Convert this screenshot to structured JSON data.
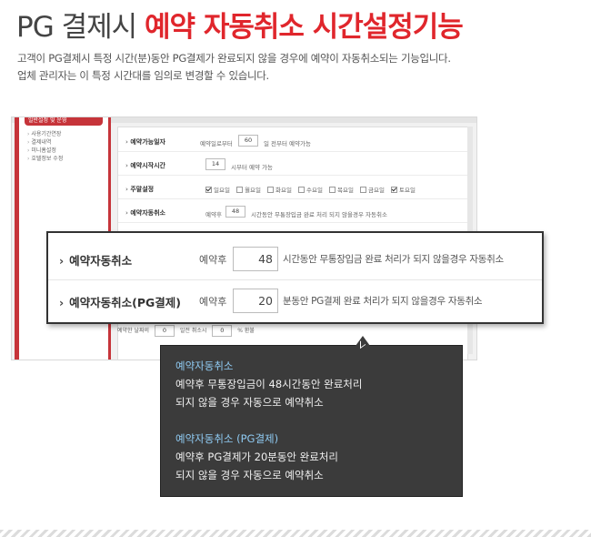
{
  "header": {
    "title_plain": "PG 결제시",
    "title_highlight": "예약 자동취소 시간설정기능",
    "desc_lines": [
      "고객이 PG결제시 특정 시간(분)동안 PG결제가 완료되지 않을 경우에 예약이 자동취소되는 기능입니다.",
      "업체 관리자는 이 특정 시간대를 임의로 변경할 수 있습니다."
    ]
  },
  "mock": {
    "sidebar_head": "일반설정 및 운영",
    "menu": [
      "사용기간연장",
      "결제내역",
      "미니홈설정",
      "호텔정보 수정"
    ],
    "rows": {
      "r1": {
        "label": "예약가능일자",
        "pre": "예약일로부터",
        "value": "60",
        "post": "일 전부터 예약가능"
      },
      "r2": {
        "label": "예약시작시간",
        "value": "14",
        "post": "시부터 예약 가능"
      },
      "r3": {
        "label": "주말설정",
        "days": [
          "일요일",
          "월요일",
          "화요일",
          "수요일",
          "목요일",
          "금요일",
          "토요일"
        ]
      },
      "r4": {
        "label": "예약자동취소",
        "pre": "예약후",
        "value": "48",
        "post": "시간동안 무통장입금 완료 처리 되지 않을경우 자동취소"
      }
    },
    "lower": {
      "a_pre": "예약한 날짜의",
      "a_value": "0",
      "a_mid": "일전 취소시",
      "a_value2": "0",
      "a_post": "% 환불"
    }
  },
  "zoom": {
    "row1": {
      "label": "예약자동취소",
      "pre": "예약후",
      "value": "48",
      "post": "시간동안 무통장입금 완료 처리가 되지 않을경우 자동취소"
    },
    "row2": {
      "label": "예약자동취소(PG결제)",
      "pre": "예약후",
      "value": "20",
      "post": "분동안 PG결제 완료 처리가 되지 않을경우 자동취소"
    }
  },
  "tooltip": {
    "s1_head": "예약자동취소",
    "s1_lines": [
      "예약후 무통장입금이 48시간동안 완료처리",
      "되지 않을 경우 자동으로 예약취소"
    ],
    "s2_head": "예약자동취소 (PG결제)",
    "s2_lines": [
      "예약후 PG결제가 20분동안 완료처리",
      "되지 않을 경우 자동으로 예약취소"
    ]
  },
  "colors": {
    "accent": "#e0262c",
    "sidebar_red": "#c6343a",
    "tooltip_bg": "#3b3b3b",
    "tooltip_head": "#8fcaf2"
  }
}
